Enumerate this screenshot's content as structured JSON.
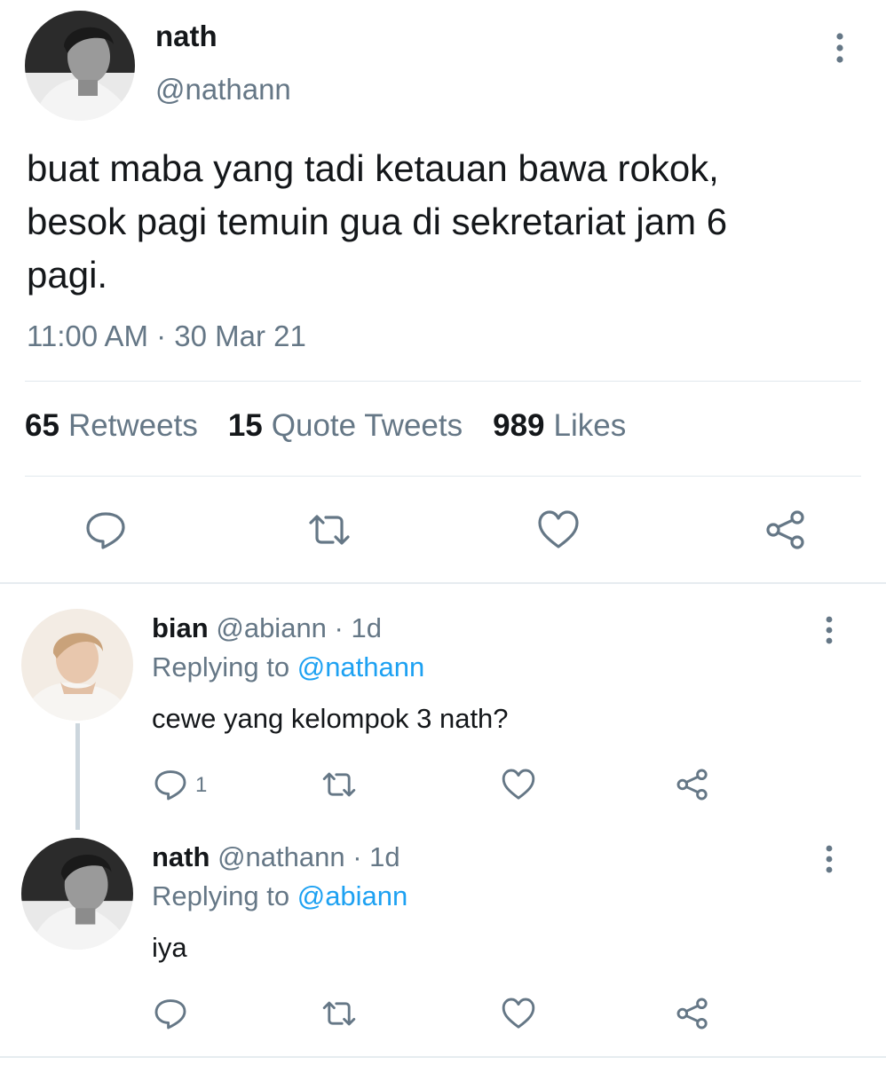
{
  "main_tweet": {
    "name": "nath",
    "handle": "@nathann",
    "text_lines": [
      "buat maba yang tadi ketauan bawa rokok,",
      "besok pagi temuin gua di sekretariat jam 6",
      "pagi."
    ],
    "timestamp": "11:00 AM · 30 Mar 21",
    "stats": {
      "retweets_count": "65",
      "retweets_label": "Retweets",
      "quotes_count": "15",
      "quotes_label": "Quote Tweets",
      "likes_count": "989",
      "likes_label": "Likes"
    },
    "icons": [
      "more-icon",
      "reply-icon",
      "retweet-icon",
      "like-icon",
      "share-icon"
    ]
  },
  "replies": [
    {
      "name": "bian",
      "handle_time": "@abiann · 1d",
      "replying_prefix": "Replying to",
      "replying_to": "@nathann",
      "text": "cewe yang kelompok 3 nath?",
      "reply_count": "1"
    },
    {
      "name": "nath",
      "handle_time": "@nathann · 1d",
      "replying_prefix": "Replying to",
      "replying_to": "@abiann",
      "text": "iya",
      "reply_count": ""
    }
  ],
  "colors": {
    "text": "#14171a",
    "secondary": "#657786",
    "accent": "#1da1f2",
    "divider": "#e1e8ed"
  }
}
